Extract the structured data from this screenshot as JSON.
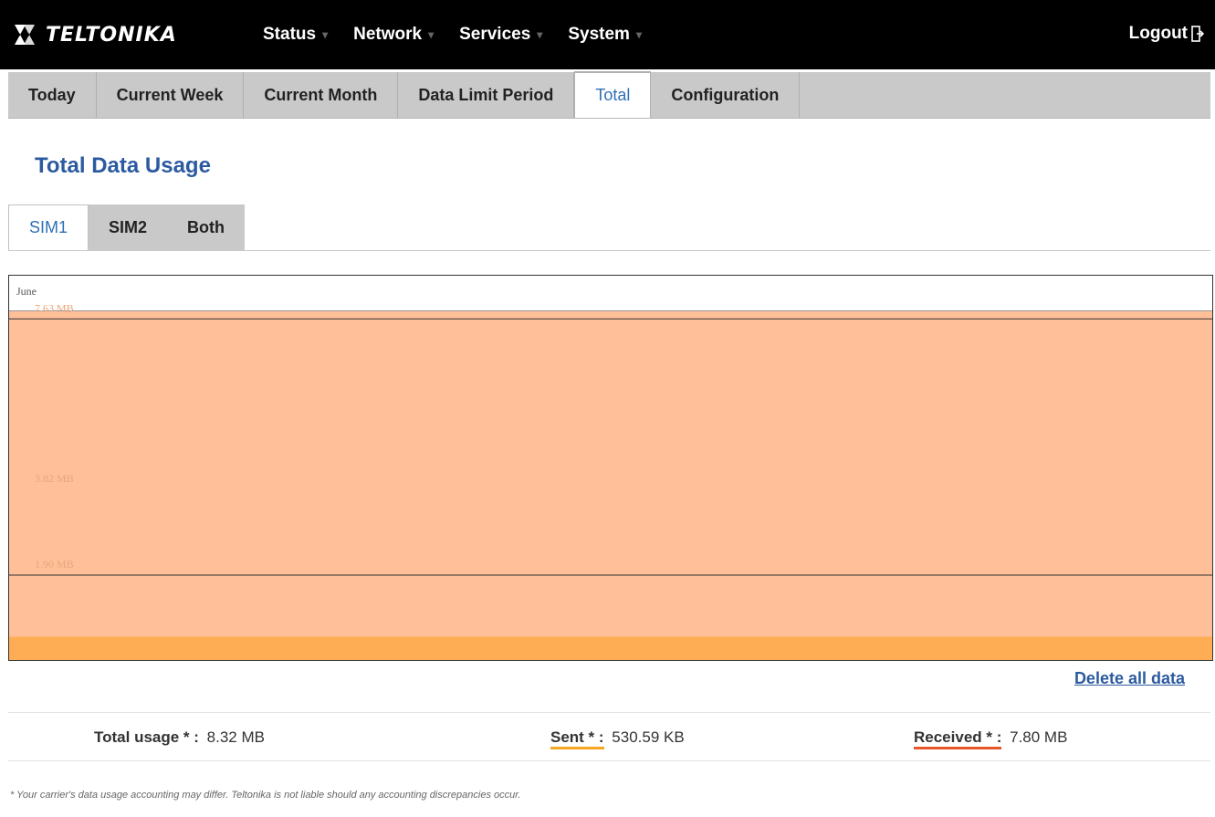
{
  "brand": {
    "name": "TELTONIKA",
    "colors": {
      "accent": "#2c5aa0",
      "topbar": "#000000",
      "received_fill": "#ffbf99",
      "sent_fill": "#ffad55"
    }
  },
  "nav": {
    "items": [
      {
        "label": "Status"
      },
      {
        "label": "Network"
      },
      {
        "label": "Services"
      },
      {
        "label": "System"
      }
    ],
    "logout": "Logout"
  },
  "subtabs": [
    "Today",
    "Current Week",
    "Current Month",
    "Data Limit Period",
    "Total",
    "Configuration"
  ],
  "active_subtab": "Total",
  "page_title": "Total Data Usage",
  "sim_tabs": [
    "SIM1",
    "SIM2",
    "Both"
  ],
  "active_sim_tab": "SIM1",
  "chart_data": {
    "type": "area",
    "x": [
      "June"
    ],
    "y_tick_labels": [
      "7.63 MB",
      "3.82 MB",
      "1.90 MB"
    ],
    "y_tick_values_mb": [
      7.63,
      3.82,
      1.9
    ],
    "series": [
      {
        "name": "Received",
        "values_mb": [
          7.8
        ],
        "color": "#ffbf99"
      },
      {
        "name": "Sent",
        "values_mb": [
          0.52
        ],
        "color": "#ffad55"
      }
    ]
  },
  "delete_link": "Delete all data",
  "summary": {
    "total": {
      "label": "Total usage * :",
      "value": "8.32 MB"
    },
    "sent": {
      "label": "Sent * :",
      "value": "530.59 KB"
    },
    "received": {
      "label": "Received * :",
      "value": "7.80 MB"
    }
  },
  "footnote": "* Your carrier's data usage accounting may differ. Teltonika is not liable should any accounting discrepancies occur."
}
